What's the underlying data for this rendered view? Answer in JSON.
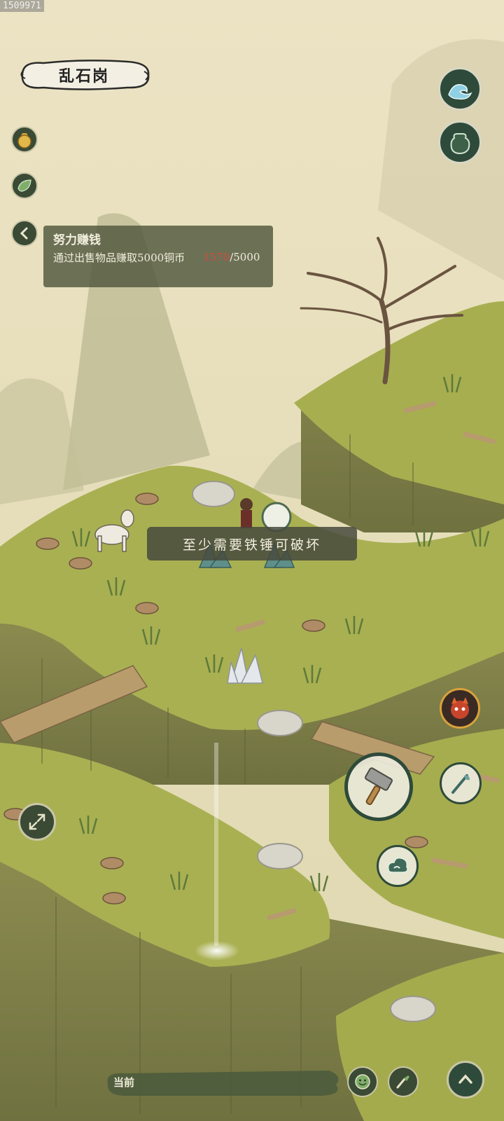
{
  "build_id": "1509971",
  "location": {
    "name": "乱石岗"
  },
  "quest": {
    "title": "努力赚钱",
    "description": "通过出售物品赚取5000铜币",
    "progress_current": "1570",
    "progress_separator": "/",
    "progress_target": "5000"
  },
  "toast": {
    "message": "至少需要铁锤可破坏"
  },
  "bottom_bar": {
    "label": "当前"
  },
  "icons": {
    "wave_button": "wave-icon",
    "bag_button": "bag-icon",
    "money_pouch": "money-pouch-icon",
    "leaf_button": "leaf-icon",
    "collapse_quest": "chevron-left-icon",
    "companion": "fox-spirit-icon",
    "hammer_action": "hammer-icon",
    "herb_tool": "herb-tool-icon",
    "cloud_action": "cloud-icon",
    "expand_view": "expand-arrows-icon",
    "emote": "smile-icon",
    "quick_tool": "brush-icon",
    "up_action": "chevron-up-icon"
  },
  "colors": {
    "sky": "#e8e0be",
    "grass": "#a9b052",
    "cliff": "#8a8a4a",
    "quest_bg": "#50583e",
    "progress_current": "#d24a3c",
    "button_ring": "#2e4a3a"
  }
}
